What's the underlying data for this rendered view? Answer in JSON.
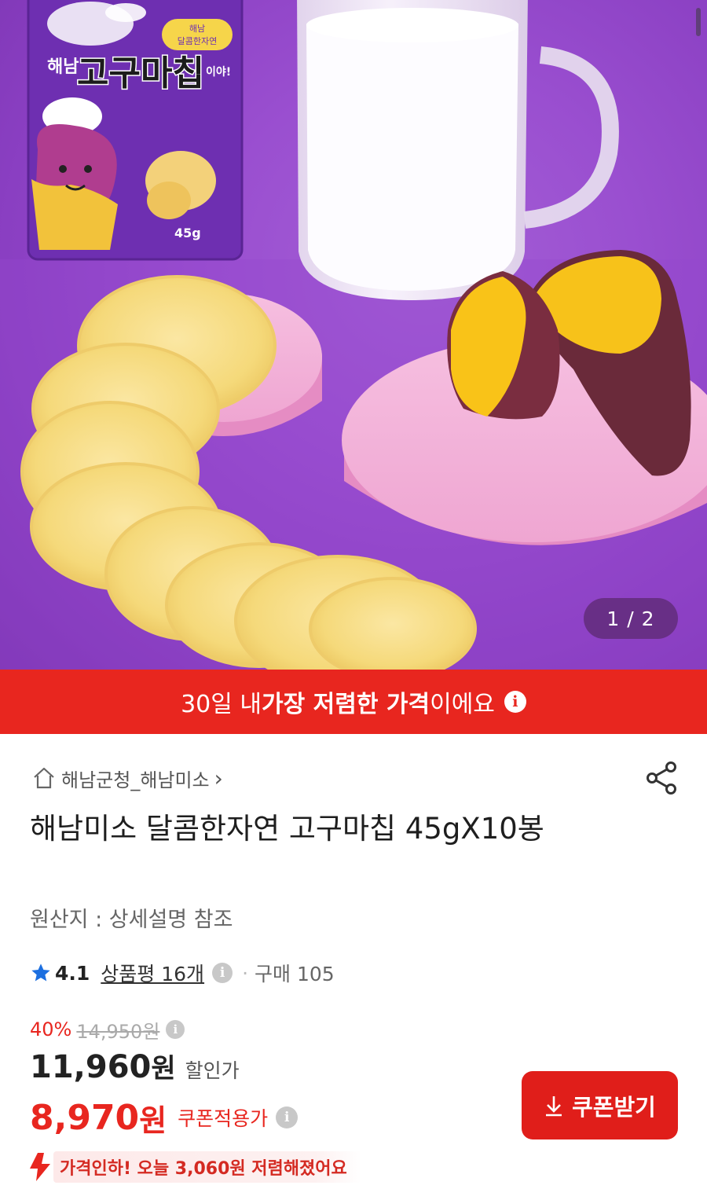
{
  "hero": {
    "page_indicator": "1 / 2",
    "package_text": {
      "region": "해남",
      "name": "고구마칩",
      "exclaim": "이야!",
      "badge_line1": "해남",
      "badge_line2": "달콤한자연",
      "weight": "45g"
    }
  },
  "banner": {
    "text_prefix": "30일 내 ",
    "text_bold": "가장 저렴한 가격",
    "text_suffix": "이에요",
    "info_glyph": "i"
  },
  "product": {
    "store_name": "해남군청_해남미소",
    "store_chevron": "›",
    "title": "해남미소 달콤한자연 고구마칩 45gX10봉",
    "origin": "원산지 : 상세설명 참조",
    "rating": "4.1",
    "reviews_label": "상품평 16개",
    "dot": "·",
    "purchases": "구매 105",
    "discount_pct": "40%",
    "original_price": "14,950원",
    "sale_price_num": "11,960",
    "sale_price_unit": "원",
    "sale_label": "할인가",
    "coupon_price_num": "8,970",
    "coupon_price_unit": "원",
    "coupon_label": "쿠폰적용가",
    "coupon_button": "쿠폰받기",
    "price_drop_notice": "가격인하! 오늘 3,060원 저렴해졌어요"
  },
  "colors": {
    "accent_red": "#e8261f",
    "hero_purple": "#9a4fd0",
    "star_blue": "#1c6fe0"
  },
  "icons": [
    "home-icon",
    "share-icon",
    "star-icon",
    "info-icon",
    "download-icon",
    "price-down-arrow-icon"
  ]
}
